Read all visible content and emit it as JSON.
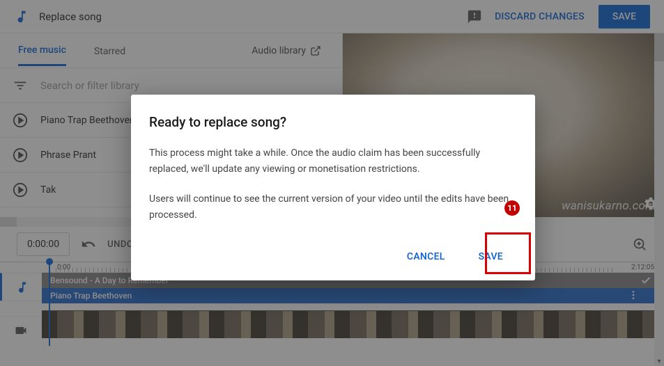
{
  "header": {
    "title": "Replace song",
    "discard": "DISCARD CHANGES",
    "save": "SAVE"
  },
  "tabs": {
    "free_music": "Free music",
    "starred": "Starred",
    "audio_library": "Audio library"
  },
  "search": {
    "placeholder": "Search or filter library"
  },
  "songs": [
    {
      "title": "Piano Trap Beethoven"
    },
    {
      "title": "Phrase Prant"
    },
    {
      "title": "Tak"
    }
  ],
  "preview": {
    "watermark": "wanisukarno.com"
  },
  "controls": {
    "time": "0:00:00",
    "undo": "UNDO"
  },
  "timeline": {
    "start": "0:00",
    "end": "2:12:05",
    "tracks": [
      {
        "label": "Bensound - A Day to Remember",
        "color": "grey",
        "icon": "check"
      },
      {
        "label": "Piano Trap Beethoven",
        "color": "blue",
        "icon": "more"
      }
    ]
  },
  "dialog": {
    "title": "Ready to replace song?",
    "p1": "This process might take a while. Once the audio claim has been successfully replaced, we'll update any viewing or monetisation restrictions.",
    "p2": "Users will continue to see the current version of your video until the edits have been processed.",
    "cancel": "CANCEL",
    "save": "SAVE"
  },
  "annotation": {
    "step": "11"
  }
}
